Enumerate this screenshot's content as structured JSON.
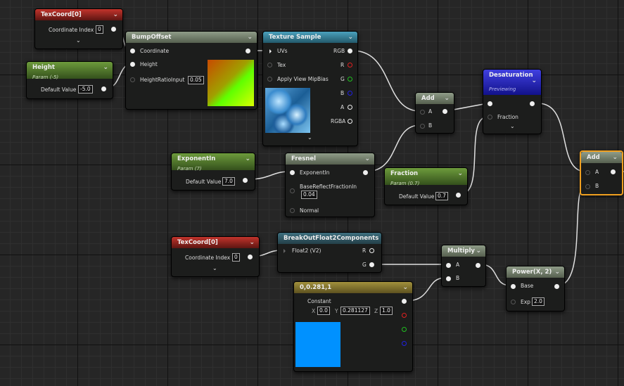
{
  "nodes": {
    "texcoord1": {
      "title": "TexCoord[0]",
      "coord_label": "Coordinate Index",
      "coord_value": "0"
    },
    "height": {
      "title": "Height",
      "subtitle": "Param (-5)",
      "value_label": "Default Value",
      "value": "-5.0"
    },
    "bumpoffset": {
      "title": "BumpOffset",
      "pin_coordinate": "Coordinate",
      "pin_height": "Height",
      "pin_ratio": "HeightRatioInput",
      "ratio_value": "0.05"
    },
    "texsample": {
      "title": "Texture Sample",
      "pin_uvs": "UVs",
      "pin_tex": "Tex",
      "pin_mip": "Apply View MipBias",
      "out_rgb": "RGB",
      "out_r": "R",
      "out_g": "G",
      "out_b": "B",
      "out_a": "A",
      "out_rgba": "RGBA"
    },
    "add1": {
      "title": "Add",
      "pin_a": "A",
      "pin_b": "B"
    },
    "desat": {
      "title": "Desaturation",
      "subtitle": "Previewing",
      "pin_fraction": "Fraction"
    },
    "add2": {
      "title": "Add",
      "pin_a": "A",
      "pin_b": "B"
    },
    "exponentin": {
      "title": "ExponentIn",
      "subtitle": "Param (7)",
      "value_label": "Default Value",
      "value": "7.0"
    },
    "fresnel": {
      "title": "Fresnel",
      "pin_exponent": "ExponentIn",
      "pin_base": "BaseReflectFractionIn",
      "base_value": "0.04",
      "pin_normal": "Normal"
    },
    "fraction": {
      "title": "Fraction",
      "subtitle": "Param (0.7)",
      "value_label": "Default Value",
      "value": "0.7"
    },
    "texcoord2": {
      "title": "TexCoord[0]",
      "coord_label": "Coordinate Index",
      "coord_value": "0"
    },
    "breakout": {
      "title": "BreakOutFloat2Components",
      "pin_float2": "Float2 (V2)",
      "out_r": "R",
      "out_g": "G"
    },
    "multiply": {
      "title": "Multiply",
      "pin_a": "A",
      "pin_b": "B"
    },
    "power": {
      "title": "Power(X, 2)",
      "pin_base": "Base",
      "pin_exp": "Exp",
      "exp_value": "2.0"
    },
    "constant": {
      "title": "0,0.281,1",
      "label": "Constant",
      "x_label": "X",
      "x_value": "0.0",
      "y_label": "Y",
      "y_value": "0.281127",
      "z_label": "Z",
      "z_value": "1.0",
      "color": "#0091ff"
    }
  },
  "colors": {
    "wire": "#e0e0e0",
    "selection": "#f0a020"
  }
}
